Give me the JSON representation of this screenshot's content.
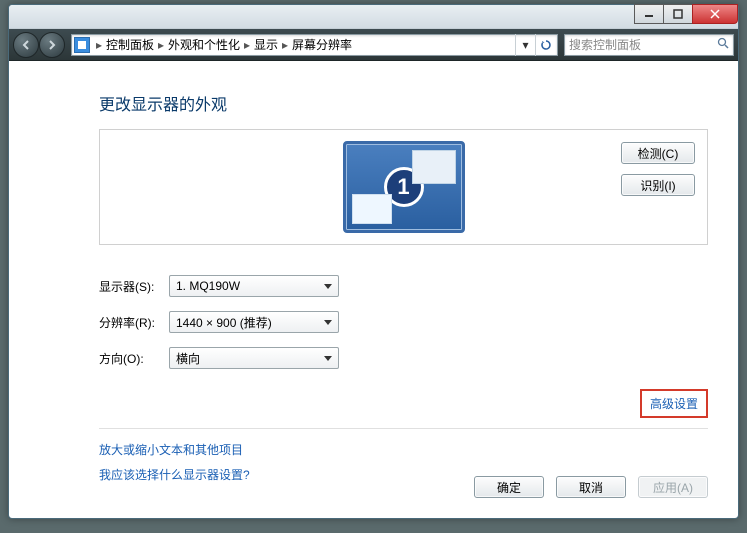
{
  "breadcrumb": {
    "items": [
      "控制面板",
      "外观和个性化",
      "显示",
      "屏幕分辨率"
    ]
  },
  "search": {
    "placeholder": "搜索控制面板"
  },
  "page": {
    "title": "更改显示器的外观",
    "detect_btn": "检测(C)",
    "identify_btn": "识别(I)",
    "monitor_number": "1"
  },
  "form": {
    "display_label": "显示器(S):",
    "display_value": "1. MQ190W",
    "resolution_label": "分辨率(R):",
    "resolution_value": "1440 × 900 (推荐)",
    "orientation_label": "方向(O):",
    "orientation_value": "横向"
  },
  "links": {
    "advanced": "高级设置",
    "text_size": "放大或缩小文本和其他项目",
    "which_display": "我应该选择什么显示器设置?"
  },
  "buttons": {
    "ok": "确定",
    "cancel": "取消",
    "apply": "应用(A)"
  }
}
